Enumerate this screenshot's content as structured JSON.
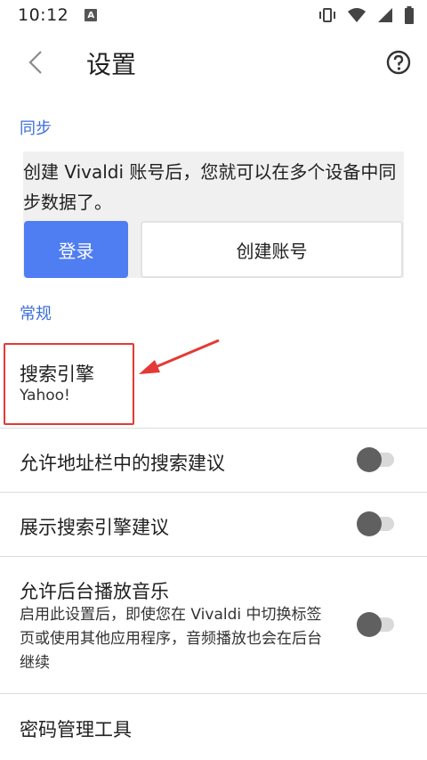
{
  "status_bar": {
    "time": "10:12",
    "notification_badge": "A",
    "icons": [
      "vibrate-icon",
      "wifi-icon",
      "signal-icon",
      "battery-icon"
    ]
  },
  "app_bar": {
    "title": "设置",
    "back_icon": "chevron-left-icon",
    "help_icon": "help-circle-icon"
  },
  "sync": {
    "header": "同步",
    "description": "创建 Vivaldi 账号后，您就可以在多个设备中同步数据了。",
    "login_label": "登录",
    "create_account_label": "创建账号"
  },
  "general": {
    "header": "常规",
    "search_engine": {
      "title": "搜索引擎",
      "value": "Yahoo!"
    },
    "settings": [
      {
        "title": "允许地址栏中的搜索建议",
        "enabled": false
      },
      {
        "title": "展示搜索引擎建议",
        "enabled": false
      },
      {
        "title": "允许后台播放音乐",
        "description": "启用此设置后，即使您在 Vivaldi 中切换标签页或使用其他应用程序，音频播放也会在后台继续",
        "enabled": false
      }
    ],
    "password_manager": "密码管理工具"
  },
  "colors": {
    "accent": "#3b6ed8",
    "login_button": "#4f7df2",
    "highlight": "#e53935"
  }
}
